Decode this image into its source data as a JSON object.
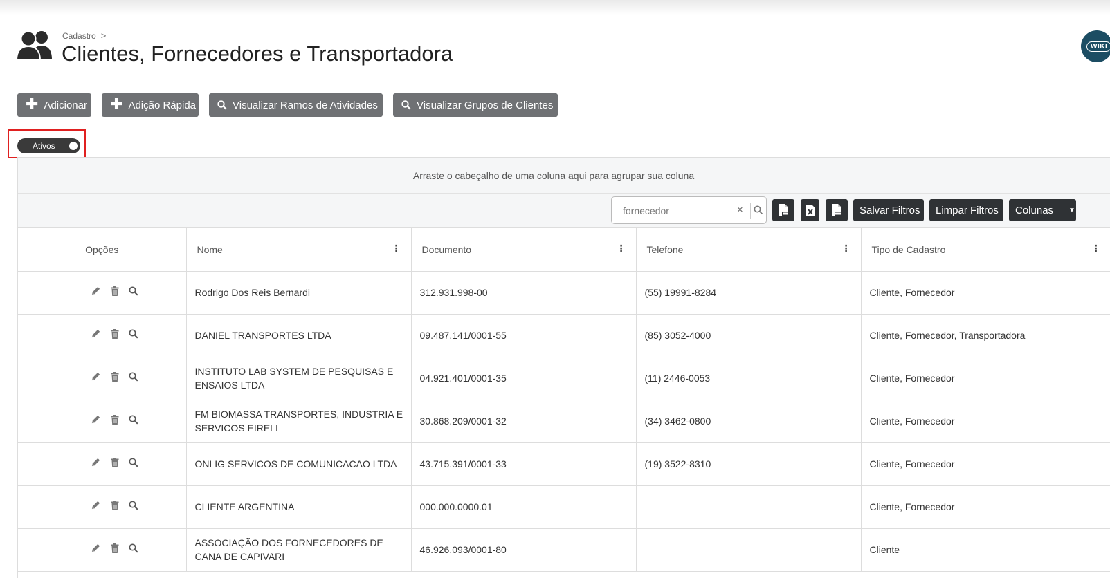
{
  "header": {
    "breadcrumb": "Cadastro",
    "breadcrumb_separator": ">",
    "title": "Clientes, Fornecedores e Transportadora",
    "wiki_label": "WIKI"
  },
  "actions": {
    "add_label": "Adicionar",
    "quick_add_label": "Adição Rápida",
    "view_branches_label": "Visualizar Ramos de Atividades",
    "view_groups_label": "Visualizar Grupos de Clientes"
  },
  "filter_toggle": {
    "label": "Ativos",
    "on": true
  },
  "grid": {
    "group_panel_text": "Arraste o cabeçalho de uma coluna aqui para agrupar sua coluna",
    "search": {
      "value": "fornecedor",
      "clear_symbol": "×"
    },
    "export_icons": [
      "pdf-file-icon",
      "excel-file-icon",
      "csv-file-icon"
    ],
    "save_filters_label": "Salvar Filtros",
    "clear_filters_label": "Limpar Filtros",
    "columns_label": "Colunas",
    "headers": {
      "options": "Opções",
      "name": "Nome",
      "document": "Documento",
      "phone": "Telefone",
      "type": "Tipo de Cadastro"
    },
    "row_action_icons": [
      "pencil-icon",
      "trash-icon",
      "search-icon"
    ],
    "rows": [
      {
        "name": "Rodrigo Dos Reis Bernardi",
        "document": "312.931.998-00",
        "phone": "(55) 19991-8284",
        "type": "Cliente, Fornecedor"
      },
      {
        "name": "DANIEL TRANSPORTES LTDA",
        "document": "09.487.141/0001-55",
        "phone": "(85) 3052-4000",
        "type": "Cliente, Fornecedor, Transportadora"
      },
      {
        "name": "INSTITUTO LAB SYSTEM DE PESQUISAS E ENSAIOS LTDA",
        "document": "04.921.401/0001-35",
        "phone": "(11) 2446-0053",
        "type": "Cliente, Fornecedor"
      },
      {
        "name": "FM BIOMASSA TRANSPORTES, INDUSTRIA E SERVICOS EIRELI",
        "document": "30.868.209/0001-32",
        "phone": "(34) 3462-0800",
        "type": "Cliente, Fornecedor"
      },
      {
        "name": "ONLIG SERVICOS DE COMUNICACAO LTDA",
        "document": "43.715.391/0001-33",
        "phone": "(19) 3522-8310",
        "type": "Cliente, Fornecedor"
      },
      {
        "name": "CLIENTE ARGENTINA",
        "document": "000.000.0000.01",
        "phone": "",
        "type": "Cliente, Fornecedor"
      },
      {
        "name": "ASSOCIAÇÃO DOS FORNECEDORES DE CANA DE CAPIVARI",
        "document": "46.926.093/0001-80",
        "phone": "",
        "type": "Cliente"
      }
    ]
  }
}
